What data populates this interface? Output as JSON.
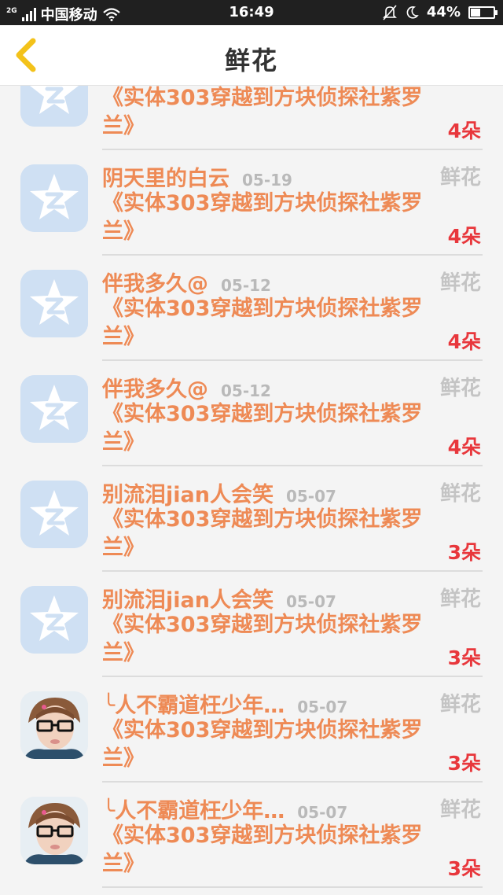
{
  "status_bar": {
    "network": "2G",
    "carrier": "中国移动",
    "time": "16:49",
    "battery": "44%",
    "battery_level": 0.44
  },
  "header": {
    "title": "鲜花"
  },
  "items": [
    {
      "name": "",
      "date": "",
      "type": "",
      "book": "《实体303穿越到方块侦探社紫罗兰》",
      "count": "4朵",
      "avatar": "qq-default-icon"
    },
    {
      "name": "阴天里的白云",
      "date": "05-19",
      "type": "鲜花",
      "book": "《实体303穿越到方块侦探社紫罗兰》",
      "count": "4朵",
      "avatar": "qq-default-icon"
    },
    {
      "name": "伴我多久@",
      "date": "05-12",
      "type": "鲜花",
      "book": "《实体303穿越到方块侦探社紫罗兰》",
      "count": "4朵",
      "avatar": "qq-default-icon"
    },
    {
      "name": "伴我多久@",
      "date": "05-12",
      "type": "鲜花",
      "book": "《实体303穿越到方块侦探社紫罗兰》",
      "count": "4朵",
      "avatar": "qq-default-icon"
    },
    {
      "name": "别流泪jian人会笑",
      "date": "05-07",
      "type": "鲜花",
      "book": "《实体303穿越到方块侦探社紫罗兰》",
      "count": "3朵",
      "avatar": "qq-default-icon"
    },
    {
      "name": "别流泪jian人会笑",
      "date": "05-07",
      "type": "鲜花",
      "book": "《实体303穿越到方块侦探社紫罗兰》",
      "count": "3朵",
      "avatar": "qq-default-icon"
    },
    {
      "name": "╰人不霸道枉少年…",
      "date": "05-07",
      "type": "鲜花",
      "book": "《实体303穿越到方块侦探社紫罗兰》",
      "count": "3朵",
      "avatar": "user-photo"
    },
    {
      "name": "╰人不霸道枉少年…",
      "date": "05-07",
      "type": "鲜花",
      "book": "《实体303穿越到方块侦探社紫罗兰》",
      "count": "3朵",
      "avatar": "user-photo"
    }
  ]
}
